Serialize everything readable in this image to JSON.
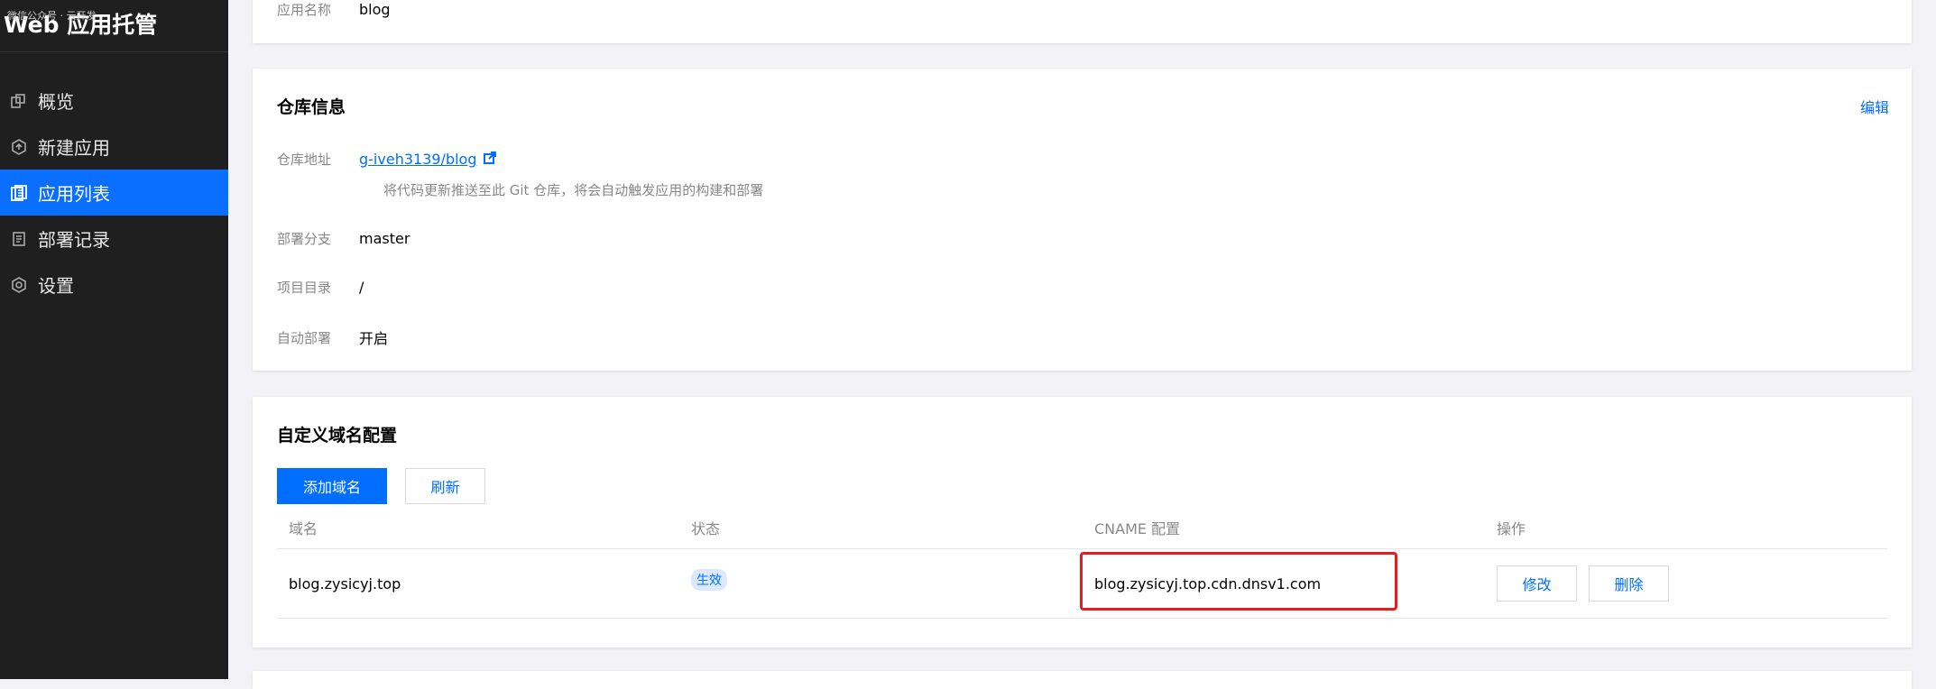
{
  "sidebar": {
    "title": "Web 应用托管",
    "subtitle": "微信公众号 · 云开发",
    "items": [
      {
        "label": "概览",
        "icon": "overview-icon",
        "active": false
      },
      {
        "label": "新建应用",
        "icon": "create-icon",
        "active": false
      },
      {
        "label": "应用列表",
        "icon": "list-icon",
        "active": true
      },
      {
        "label": "部署记录",
        "icon": "record-icon",
        "active": false
      },
      {
        "label": "设置",
        "icon": "settings-icon",
        "active": false
      }
    ]
  },
  "app_info": {
    "name_label": "应用名称",
    "name_value": "blog"
  },
  "repo": {
    "title": "仓库信息",
    "edit_label": "编辑",
    "address_label": "仓库地址",
    "address_value": "g-iveh3139/blog",
    "hint": "将代码更新推送至此 Git 仓库，将会自动触发应用的构建和部署",
    "branch_label": "部署分支",
    "branch_value": "master",
    "dir_label": "项目目录",
    "dir_value": "/",
    "auto_label": "自动部署",
    "auto_value": "开启"
  },
  "domain": {
    "title": "自定义域名配置",
    "add_label": "添加域名",
    "refresh_label": "刷新",
    "columns": [
      "域名",
      "状态",
      "CNAME 配置",
      "操作"
    ],
    "rows": [
      {
        "domain": "blog.zysicyj.top",
        "status": "生效",
        "cname": "blog.zysicyj.top.cdn.dnsv1.com",
        "edit_label": "修改",
        "delete_label": "删除"
      }
    ]
  },
  "colors": {
    "accent": "#006eff",
    "sidebar_bg": "#1f1f1f",
    "highlight": "#e02020"
  }
}
